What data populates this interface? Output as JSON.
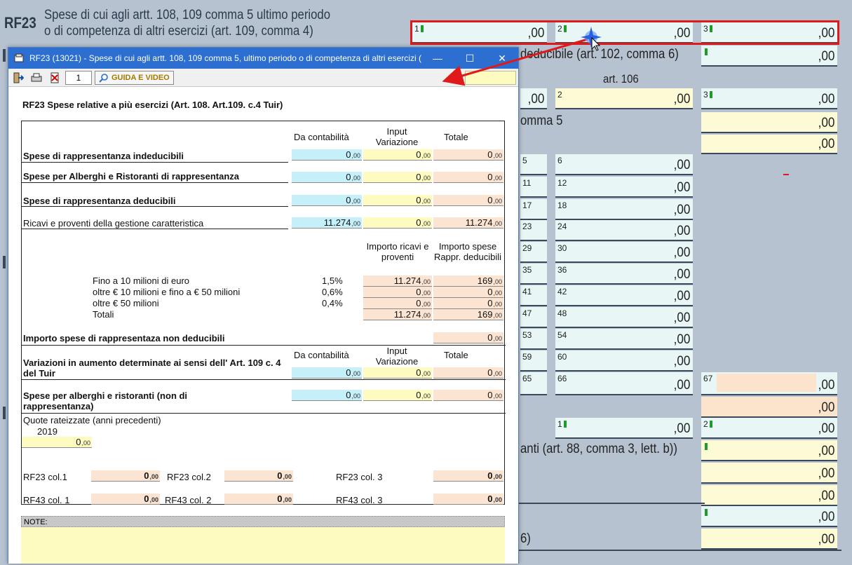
{
  "background": {
    "code": "RF23",
    "title_line1": "Spese di cui agli artt. 108, 109 comma 5 ultimo periodo",
    "title_line2": "o di competenza di altri esercizi (art. 109, comma 4)",
    "cell_value": ",00",
    "texts": {
      "deducibile": "deducibile (art. 102, comma 6)",
      "art106": "art. 106",
      "comma5": "omma 5",
      "anti": "anti (art. 88, comma 3, lett. b))",
      "six": "6)"
    },
    "row_numbers": [
      "5",
      "6",
      "11",
      "12",
      "17",
      "18",
      "23",
      "24",
      "29",
      "30",
      "35",
      "36",
      "41",
      "42",
      "47",
      "48",
      "53",
      "54",
      "59",
      "60",
      "65",
      "66",
      "67"
    ],
    "cols_top": [
      "1",
      "2",
      "3"
    ]
  },
  "dialog": {
    "title": "RF23 (13021) - Spese di cui agli artt. 108, 109 comma 5, ultimo periodo o di competenza di altri esercizi (a...",
    "window_buttons": {
      "minimize": "—",
      "maximize": "☐",
      "close": "✕"
    },
    "toolbar": {
      "exit_icon": "exit-icon",
      "print_icon": "print-icon",
      "delete_icon": "delete-icon",
      "page_number": "1",
      "guide_label": "GUIDA E VIDEO"
    },
    "heading": "RF23 Spese relative a più esercizi  (Art. 108. Art.109. c.4 Tuir)",
    "headers": {
      "contabilita": "Da contabilità",
      "input": "Input Variazione",
      "totale": "Totale"
    },
    "rows": [
      {
        "label": "Spese di rappresentanza indeducibili",
        "a": "0",
        "b": "0",
        "c": "0"
      },
      {
        "label": "Spese per Alberghi e Ristoranti di rappresentanza",
        "a": "0",
        "b": "0",
        "c": "0"
      },
      {
        "label": "Spese di rappresentanza deducibili",
        "a": "0",
        "b": "0",
        "c": "0"
      },
      {
        "label": "Ricavi e proventi della gestione caratteristica",
        "a": "11.274",
        "b": "0",
        "c": "11.274"
      }
    ],
    "bracket_headers": {
      "ricavi": "Importo ricavi e proventi",
      "spese": "Importo spese Rappr. deducibili"
    },
    "brackets": [
      {
        "label": "Fino a 10 milioni di euro",
        "pct": "1,5%",
        "ricavi": "11.274",
        "spese": "169"
      },
      {
        "label": "oltre € 10 milioni e fino a € 50 milioni",
        "pct": "0,6%",
        "ricavi": "0",
        "spese": "0"
      },
      {
        "label": "oltre € 50 milioni",
        "pct": "0,4%",
        "ricavi": "0",
        "spese": "0"
      },
      {
        "label": "Totali",
        "pct": "",
        "ricavi": "11.274",
        "spese": "169"
      }
    ],
    "non_deducibili": {
      "label": "Importo spese di rappresentaza non deducibili",
      "value": "0"
    },
    "variazioni": {
      "label": "Variazioni in aumento determinate ai sensi dell' Art. 109 c. 4 del Tuir",
      "a": "0",
      "b": "0",
      "c": "0"
    },
    "alberghi": {
      "label": "Spese per alberghi e ristoranti (non di rappresentanza)",
      "a": "0",
      "b": "0",
      "c": "0"
    },
    "quote": {
      "label": "Quote rateizzate (anni precedenti)",
      "year": "2019",
      "value": "0"
    },
    "summary": [
      {
        "l1": "RF23 col.1",
        "v1": "0",
        "l2": "RF23 col.2",
        "v2": "0",
        "l3": "RF23 col. 3",
        "v3": "0"
      },
      {
        "l1": "RF43 col. 1",
        "v1": "0",
        "l2": "RF43 col. 2",
        "v2": "0",
        "l3": "RF43 col. 3",
        "v3": "0"
      }
    ],
    "decimals": ",00",
    "notes_label": "NOTE:"
  },
  "colors": {
    "titlebar": "#2c6fd0",
    "highlight": "#e01a1a",
    "cyan": "#c5f0fa",
    "yellow": "#fdfbbf",
    "peach": "#fce4d2"
  }
}
